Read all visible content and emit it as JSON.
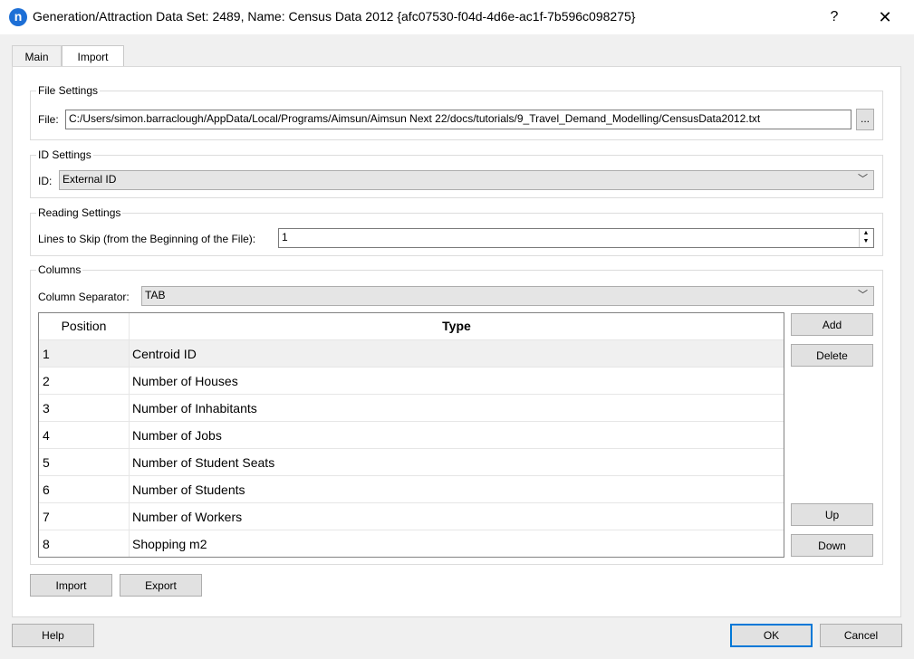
{
  "window": {
    "title": "Generation/Attraction Data Set: 2489, Name: Census Data 2012  {afc07530-f04d-4d6e-ac1f-7b596c098275}",
    "logo_letter": "n",
    "help_label": "?",
    "close_label": "✕"
  },
  "tabs": [
    {
      "label": "Main",
      "active": false
    },
    {
      "label": "Import",
      "active": true
    }
  ],
  "file_settings": {
    "title": "File Settings",
    "file_label": "File:",
    "file_path": "C:/Users/simon.barraclough/AppData/Local/Programs/Aimsun/Aimsun Next 22/docs/tutorials/9_Travel_Demand_Modelling/CensusData2012.txt",
    "browse_label": "..."
  },
  "id_settings": {
    "title": "ID Settings",
    "id_label": "ID:",
    "id_value": "External ID"
  },
  "reading_settings": {
    "title": "Reading Settings",
    "lines_label": "Lines to Skip (from the Beginning of the File):",
    "lines_value": "1"
  },
  "columns": {
    "title": "Columns",
    "separator_label": "Column Separator:",
    "separator_value": "TAB",
    "headers": {
      "position": "Position",
      "type": "Type"
    },
    "rows": [
      {
        "position": "1",
        "type": "Centroid ID"
      },
      {
        "position": "2",
        "type": "Number of Houses"
      },
      {
        "position": "3",
        "type": "Number of Inhabitants"
      },
      {
        "position": "4",
        "type": "Number of Jobs"
      },
      {
        "position": "5",
        "type": "Number of Student Seats"
      },
      {
        "position": "6",
        "type": "Number of Students"
      },
      {
        "position": "7",
        "type": "Number of Workers"
      },
      {
        "position": "8",
        "type": "Shopping m2"
      }
    ],
    "add_label": "Add",
    "delete_label": "Delete",
    "up_label": "Up",
    "down_label": "Down"
  },
  "import_label": "Import",
  "export_label": "Export",
  "footer": {
    "help_label": "Help",
    "ok_label": "OK",
    "cancel_label": "Cancel"
  }
}
